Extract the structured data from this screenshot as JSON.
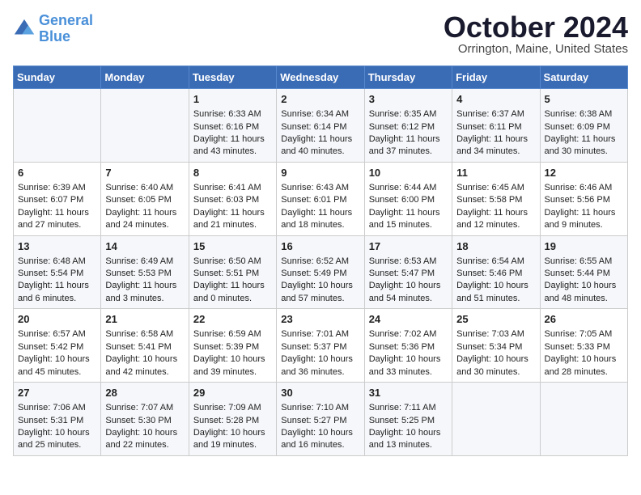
{
  "header": {
    "logo_line1": "General",
    "logo_line2": "Blue",
    "month": "October 2024",
    "location": "Orrington, Maine, United States"
  },
  "weekdays": [
    "Sunday",
    "Monday",
    "Tuesday",
    "Wednesday",
    "Thursday",
    "Friday",
    "Saturday"
  ],
  "weeks": [
    [
      {
        "day": "",
        "info": ""
      },
      {
        "day": "",
        "info": ""
      },
      {
        "day": "1",
        "info": "Sunrise: 6:33 AM\nSunset: 6:16 PM\nDaylight: 11 hours and 43 minutes."
      },
      {
        "day": "2",
        "info": "Sunrise: 6:34 AM\nSunset: 6:14 PM\nDaylight: 11 hours and 40 minutes."
      },
      {
        "day": "3",
        "info": "Sunrise: 6:35 AM\nSunset: 6:12 PM\nDaylight: 11 hours and 37 minutes."
      },
      {
        "day": "4",
        "info": "Sunrise: 6:37 AM\nSunset: 6:11 PM\nDaylight: 11 hours and 34 minutes."
      },
      {
        "day": "5",
        "info": "Sunrise: 6:38 AM\nSunset: 6:09 PM\nDaylight: 11 hours and 30 minutes."
      }
    ],
    [
      {
        "day": "6",
        "info": "Sunrise: 6:39 AM\nSunset: 6:07 PM\nDaylight: 11 hours and 27 minutes."
      },
      {
        "day": "7",
        "info": "Sunrise: 6:40 AM\nSunset: 6:05 PM\nDaylight: 11 hours and 24 minutes."
      },
      {
        "day": "8",
        "info": "Sunrise: 6:41 AM\nSunset: 6:03 PM\nDaylight: 11 hours and 21 minutes."
      },
      {
        "day": "9",
        "info": "Sunrise: 6:43 AM\nSunset: 6:01 PM\nDaylight: 11 hours and 18 minutes."
      },
      {
        "day": "10",
        "info": "Sunrise: 6:44 AM\nSunset: 6:00 PM\nDaylight: 11 hours and 15 minutes."
      },
      {
        "day": "11",
        "info": "Sunrise: 6:45 AM\nSunset: 5:58 PM\nDaylight: 11 hours and 12 minutes."
      },
      {
        "day": "12",
        "info": "Sunrise: 6:46 AM\nSunset: 5:56 PM\nDaylight: 11 hours and 9 minutes."
      }
    ],
    [
      {
        "day": "13",
        "info": "Sunrise: 6:48 AM\nSunset: 5:54 PM\nDaylight: 11 hours and 6 minutes."
      },
      {
        "day": "14",
        "info": "Sunrise: 6:49 AM\nSunset: 5:53 PM\nDaylight: 11 hours and 3 minutes."
      },
      {
        "day": "15",
        "info": "Sunrise: 6:50 AM\nSunset: 5:51 PM\nDaylight: 11 hours and 0 minutes."
      },
      {
        "day": "16",
        "info": "Sunrise: 6:52 AM\nSunset: 5:49 PM\nDaylight: 10 hours and 57 minutes."
      },
      {
        "day": "17",
        "info": "Sunrise: 6:53 AM\nSunset: 5:47 PM\nDaylight: 10 hours and 54 minutes."
      },
      {
        "day": "18",
        "info": "Sunrise: 6:54 AM\nSunset: 5:46 PM\nDaylight: 10 hours and 51 minutes."
      },
      {
        "day": "19",
        "info": "Sunrise: 6:55 AM\nSunset: 5:44 PM\nDaylight: 10 hours and 48 minutes."
      }
    ],
    [
      {
        "day": "20",
        "info": "Sunrise: 6:57 AM\nSunset: 5:42 PM\nDaylight: 10 hours and 45 minutes."
      },
      {
        "day": "21",
        "info": "Sunrise: 6:58 AM\nSunset: 5:41 PM\nDaylight: 10 hours and 42 minutes."
      },
      {
        "day": "22",
        "info": "Sunrise: 6:59 AM\nSunset: 5:39 PM\nDaylight: 10 hours and 39 minutes."
      },
      {
        "day": "23",
        "info": "Sunrise: 7:01 AM\nSunset: 5:37 PM\nDaylight: 10 hours and 36 minutes."
      },
      {
        "day": "24",
        "info": "Sunrise: 7:02 AM\nSunset: 5:36 PM\nDaylight: 10 hours and 33 minutes."
      },
      {
        "day": "25",
        "info": "Sunrise: 7:03 AM\nSunset: 5:34 PM\nDaylight: 10 hours and 30 minutes."
      },
      {
        "day": "26",
        "info": "Sunrise: 7:05 AM\nSunset: 5:33 PM\nDaylight: 10 hours and 28 minutes."
      }
    ],
    [
      {
        "day": "27",
        "info": "Sunrise: 7:06 AM\nSunset: 5:31 PM\nDaylight: 10 hours and 25 minutes."
      },
      {
        "day": "28",
        "info": "Sunrise: 7:07 AM\nSunset: 5:30 PM\nDaylight: 10 hours and 22 minutes."
      },
      {
        "day": "29",
        "info": "Sunrise: 7:09 AM\nSunset: 5:28 PM\nDaylight: 10 hours and 19 minutes."
      },
      {
        "day": "30",
        "info": "Sunrise: 7:10 AM\nSunset: 5:27 PM\nDaylight: 10 hours and 16 minutes."
      },
      {
        "day": "31",
        "info": "Sunrise: 7:11 AM\nSunset: 5:25 PM\nDaylight: 10 hours and 13 minutes."
      },
      {
        "day": "",
        "info": ""
      },
      {
        "day": "",
        "info": ""
      }
    ]
  ]
}
